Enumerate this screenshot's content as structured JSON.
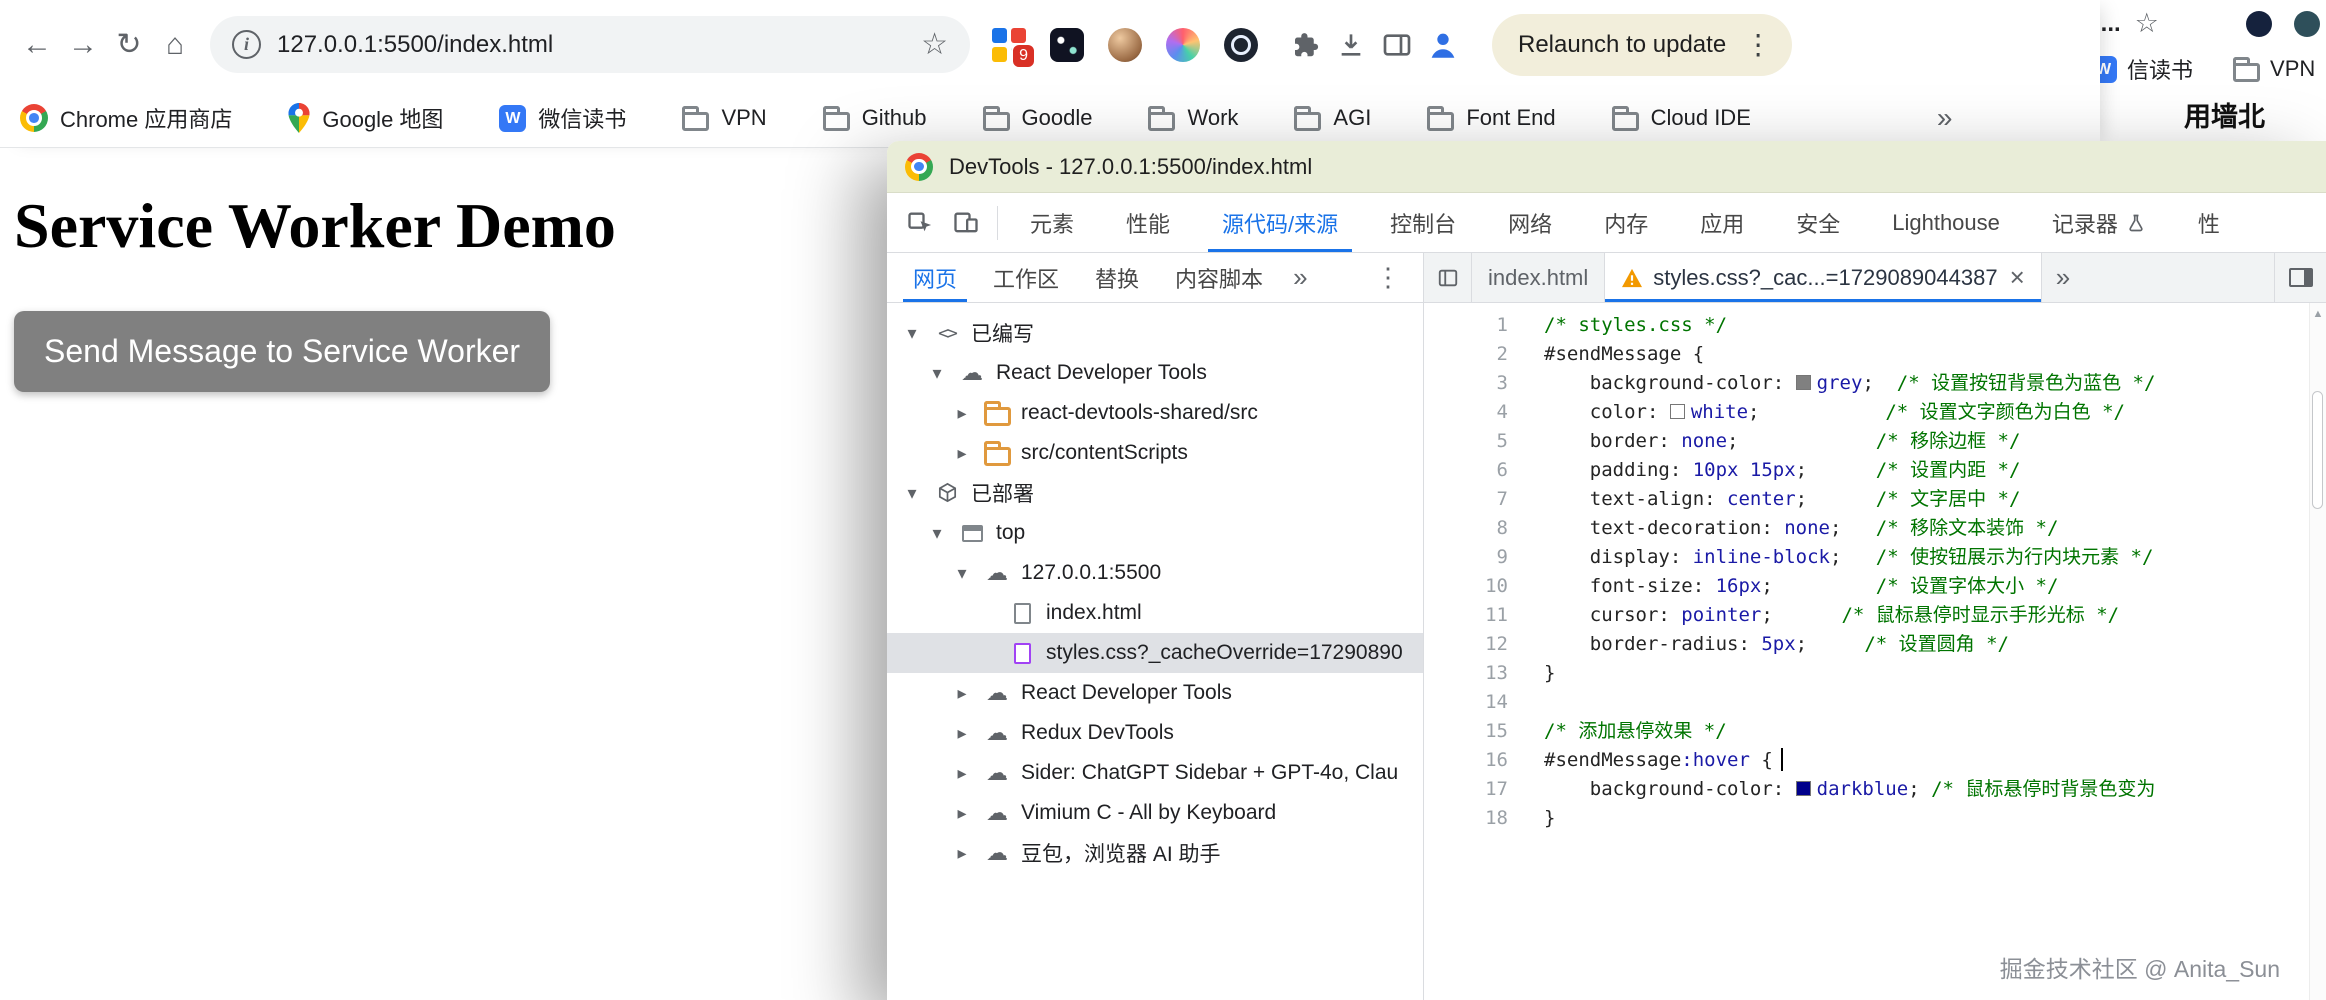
{
  "browser": {
    "url": "127.0.0.1:5500/index.html",
    "relaunch_button": "Relaunch to update",
    "extension_badge": "9",
    "bookmarks": [
      {
        "label": "Chrome 应用商店",
        "icon": "chrome-icon"
      },
      {
        "label": "Google 地图",
        "icon": "maps-pin-icon"
      },
      {
        "label": "微信读书",
        "icon": "weread-icon"
      },
      {
        "label": "VPN",
        "icon": "folder-icon"
      },
      {
        "label": "Github",
        "icon": "folder-icon"
      },
      {
        "label": "Goodle",
        "icon": "folder-icon"
      },
      {
        "label": "Work",
        "icon": "folder-icon"
      },
      {
        "label": "AGI",
        "icon": "folder-icon"
      },
      {
        "label": "Font End",
        "icon": "folder-icon"
      },
      {
        "label": "Cloud IDE",
        "icon": "folder-icon"
      }
    ]
  },
  "background_window": {
    "tab_fragment": "d...",
    "page_fragment": "用墙北",
    "bookmarks": [
      {
        "label": "信读书",
        "icon": "weread-icon"
      },
      {
        "label": "VPN",
        "icon": "folder-icon"
      }
    ]
  },
  "page": {
    "heading": "Service Worker Demo",
    "button_label": "Send Message to Service Worker"
  },
  "devtools": {
    "title": "DevTools - 127.0.0.1:5500/index.html",
    "toolbar_tabs": [
      {
        "label": "元素"
      },
      {
        "label": "性能"
      },
      {
        "label": "源代码/来源",
        "active": true
      },
      {
        "label": "控制台"
      },
      {
        "label": "网络"
      },
      {
        "label": "内存"
      },
      {
        "label": "应用"
      },
      {
        "label": "安全"
      },
      {
        "label": "Lighthouse"
      },
      {
        "label": "记录器",
        "flask": true
      },
      {
        "label": "性"
      }
    ],
    "nav_tabs": [
      {
        "label": "网页",
        "active": true
      },
      {
        "label": "工作区"
      },
      {
        "label": "替换"
      },
      {
        "label": "内容脚本"
      }
    ],
    "tree": [
      {
        "depth": 0,
        "arrow": "down",
        "icon": "code-icon",
        "label": "已编写"
      },
      {
        "depth": 1,
        "arrow": "down",
        "icon": "cloud-icon",
        "label": "React Developer Tools"
      },
      {
        "depth": 2,
        "arrow": "right",
        "icon": "folder-icon",
        "label": "react-devtools-shared/src"
      },
      {
        "depth": 2,
        "arrow": "right",
        "icon": "folder-icon",
        "label": "src/contentScripts"
      },
      {
        "depth": 0,
        "arrow": "down",
        "icon": "cube-icon",
        "label": "已部署"
      },
      {
        "depth": 1,
        "arrow": "down",
        "icon": "frame-icon",
        "label": "top"
      },
      {
        "depth": 2,
        "arrow": "down",
        "icon": "cloud-icon",
        "label": "127.0.0.1:5500"
      },
      {
        "depth": 3,
        "arrow": "none",
        "icon": "doc-icon",
        "label": "index.html"
      },
      {
        "depth": 3,
        "arrow": "none",
        "icon": "css-doc-icon",
        "label": "styles.css?_cacheOverride=17290890",
        "selected": true
      },
      {
        "depth": 2,
        "arrow": "right",
        "icon": "cloud-icon",
        "label": "React Developer Tools"
      },
      {
        "depth": 2,
        "arrow": "right",
        "icon": "cloud-icon",
        "label": "Redux DevTools"
      },
      {
        "depth": 2,
        "arrow": "right",
        "icon": "cloud-icon",
        "label": "Sider: ChatGPT Sidebar + GPT-4o, Clau"
      },
      {
        "depth": 2,
        "arrow": "right",
        "icon": "cloud-icon",
        "label": "Vimium C - All by Keyboard"
      },
      {
        "depth": 2,
        "arrow": "right",
        "icon": "cloud-icon",
        "label": "豆包，浏览器 AI 助手"
      }
    ],
    "editor_tabs": [
      {
        "label": "index.html"
      },
      {
        "label": "styles.css?_cac...=1729089044387",
        "active": true,
        "warning": true,
        "closable": true
      }
    ],
    "watermark": "掘金技术社区 @ Anita_Sun",
    "code": {
      "value_color": "#1a1aa6",
      "comment_color": "#007400",
      "lines": [
        [
          {
            "k": "c",
            "s": "/* styles.css */"
          }
        ],
        [
          {
            "k": "t",
            "s": "#sendMessage {"
          }
        ],
        [
          {
            "k": "t",
            "s": "    background-color: "
          },
          {
            "k": "sw",
            "c": "#808080"
          },
          {
            "k": "v",
            "s": "grey"
          },
          {
            "k": "t",
            "s": ";  "
          },
          {
            "k": "c",
            "s": "/* 设置按钮背景色为蓝色 */"
          }
        ],
        [
          {
            "k": "t",
            "s": "    color: "
          },
          {
            "k": "sw",
            "c": "#ffffff"
          },
          {
            "k": "v",
            "s": "white"
          },
          {
            "k": "t",
            "s": ";           "
          },
          {
            "k": "c",
            "s": "/* 设置文字颜色为白色 */"
          }
        ],
        [
          {
            "k": "t",
            "s": "    border: "
          },
          {
            "k": "v",
            "s": "none"
          },
          {
            "k": "t",
            "s": ";            "
          },
          {
            "k": "c",
            "s": "/* 移除边框 */"
          }
        ],
        [
          {
            "k": "t",
            "s": "    padding: "
          },
          {
            "k": "v",
            "s": "10px 15px"
          },
          {
            "k": "t",
            "s": ";      "
          },
          {
            "k": "c",
            "s": "/* 设置内距 */"
          }
        ],
        [
          {
            "k": "t",
            "s": "    text-align: "
          },
          {
            "k": "v",
            "s": "center"
          },
          {
            "k": "t",
            "s": ";      "
          },
          {
            "k": "c",
            "s": "/* 文字居中 */"
          }
        ],
        [
          {
            "k": "t",
            "s": "    text-decoration: "
          },
          {
            "k": "v",
            "s": "none"
          },
          {
            "k": "t",
            "s": ";   "
          },
          {
            "k": "c",
            "s": "/* 移除文本装饰 */"
          }
        ],
        [
          {
            "k": "t",
            "s": "    display: "
          },
          {
            "k": "v",
            "s": "inline-block"
          },
          {
            "k": "t",
            "s": ";   "
          },
          {
            "k": "c",
            "s": "/* 使按钮展示为行内块元素 */"
          }
        ],
        [
          {
            "k": "t",
            "s": "    font-size: "
          },
          {
            "k": "v",
            "s": "16px"
          },
          {
            "k": "t",
            "s": ";         "
          },
          {
            "k": "c",
            "s": "/* 设置字体大小 */"
          }
        ],
        [
          {
            "k": "t",
            "s": "    cursor: "
          },
          {
            "k": "v",
            "s": "pointer"
          },
          {
            "k": "t",
            "s": ";      "
          },
          {
            "k": "c",
            "s": "/* 鼠标悬停时显示手形光标 */"
          }
        ],
        [
          {
            "k": "t",
            "s": "    border-radius: "
          },
          {
            "k": "v",
            "s": "5px"
          },
          {
            "k": "t",
            "s": ";     "
          },
          {
            "k": "c",
            "s": "/* 设置圆角 */"
          }
        ],
        [
          {
            "k": "t",
            "s": "}"
          }
        ],
        [],
        [
          {
            "k": "c",
            "s": "/* 添加悬停效果 */"
          }
        ],
        [
          {
            "k": "t",
            "s": "#sendMessage"
          },
          {
            "k": "v",
            "s": ":hover"
          },
          {
            "k": "t",
            "s": " {"
          },
          {
            "k": "caret"
          }
        ],
        [
          {
            "k": "t",
            "s": "    background-color: "
          },
          {
            "k": "sw",
            "c": "#00008b"
          },
          {
            "k": "v",
            "s": "darkblue"
          },
          {
            "k": "t",
            "s": "; "
          },
          {
            "k": "c",
            "s": "/* 鼠标悬停时背景色变为"
          }
        ],
        [
          {
            "k": "t",
            "s": "}"
          }
        ]
      ]
    }
  }
}
